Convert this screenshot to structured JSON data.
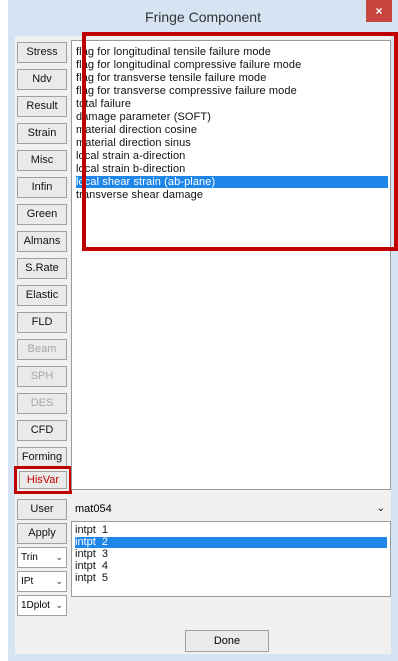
{
  "window": {
    "title": "Fringe Component",
    "close_glyph": "×"
  },
  "sidebar": {
    "buttons": [
      {
        "label": "Stress",
        "disabled": false
      },
      {
        "label": "Ndv",
        "disabled": false
      },
      {
        "label": "Result",
        "disabled": false
      },
      {
        "label": "Strain",
        "disabled": false
      },
      {
        "label": "Misc",
        "disabled": false
      },
      {
        "label": "Infin",
        "disabled": false
      },
      {
        "label": "Green",
        "disabled": false
      },
      {
        "label": "Almans",
        "disabled": false
      },
      {
        "label": "S.Rate",
        "disabled": false
      },
      {
        "label": "Elastic",
        "disabled": false
      },
      {
        "label": "FLD",
        "disabled": false
      },
      {
        "label": "Beam",
        "disabled": true
      },
      {
        "label": "SPH",
        "disabled": true
      },
      {
        "label": "DES",
        "disabled": true
      },
      {
        "label": "CFD",
        "disabled": false
      },
      {
        "label": "Forming",
        "disabled": false
      }
    ],
    "hisvar_label": "HisVar",
    "user_label": "User",
    "apply_label": "Apply",
    "selects": [
      {
        "value": "Trin"
      },
      {
        "value": "IPt"
      },
      {
        "value": "1Dplot"
      }
    ]
  },
  "components": {
    "items": [
      "flag for longitudinal tensile failure mode",
      "flag for longitudinal compressive failure mode",
      "flag for transverse tensile failure mode",
      "flag for transverse compressive failure mode",
      "total failure",
      "damage parameter (SOFT)",
      "material direction cosine",
      "material direction sinus",
      "local strain a-direction",
      "local strain b-direction",
      "local shear strain (ab-plane)",
      "transverse shear damage"
    ],
    "selected_index": 10
  },
  "material": {
    "value": "mat054"
  },
  "integration_points": {
    "items": [
      "intpt  1",
      "intpt  2",
      "intpt  3",
      "intpt  4",
      "intpt  5"
    ],
    "selected_index": 1
  },
  "footer": {
    "done_label": "Done"
  },
  "colors": {
    "selection": "#1e86e8",
    "highlight_frame": "#c00000",
    "close_bg": "#c7453f"
  },
  "icons": {
    "dropdown": "chevron-down-icon",
    "close": "close-icon"
  }
}
